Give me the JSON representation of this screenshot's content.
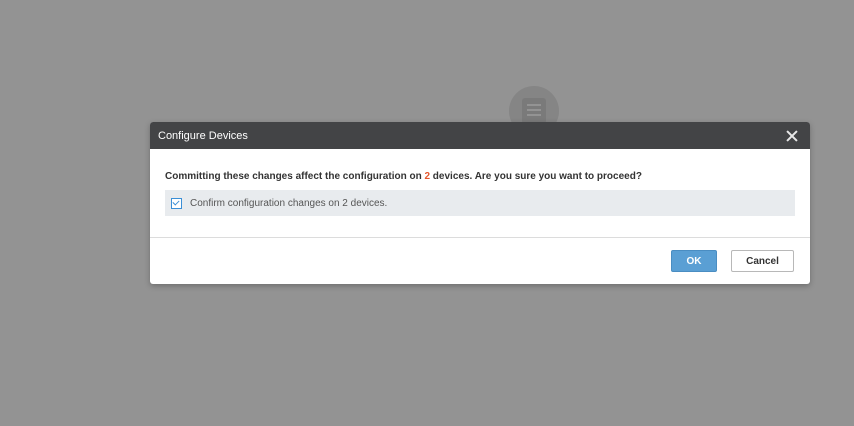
{
  "dialog": {
    "title": "Configure Devices",
    "message_prefix": "Committing these changes affect the configuration on ",
    "device_count": "2",
    "message_suffix": " devices. Are you sure you want to proceed?",
    "confirm_label": "Confirm configuration changes on 2 devices.",
    "confirm_checked": true,
    "ok_label": "OK",
    "cancel_label": "Cancel"
  },
  "colors": {
    "header_bg": "#434446",
    "accent_count": "#e5582e",
    "ok_button": "#5a9fd4",
    "checkbox": "#3b8fd6"
  },
  "icons": {
    "background": "document-icon",
    "close": "close-icon",
    "checkbox": "checkbox-checked-icon"
  }
}
